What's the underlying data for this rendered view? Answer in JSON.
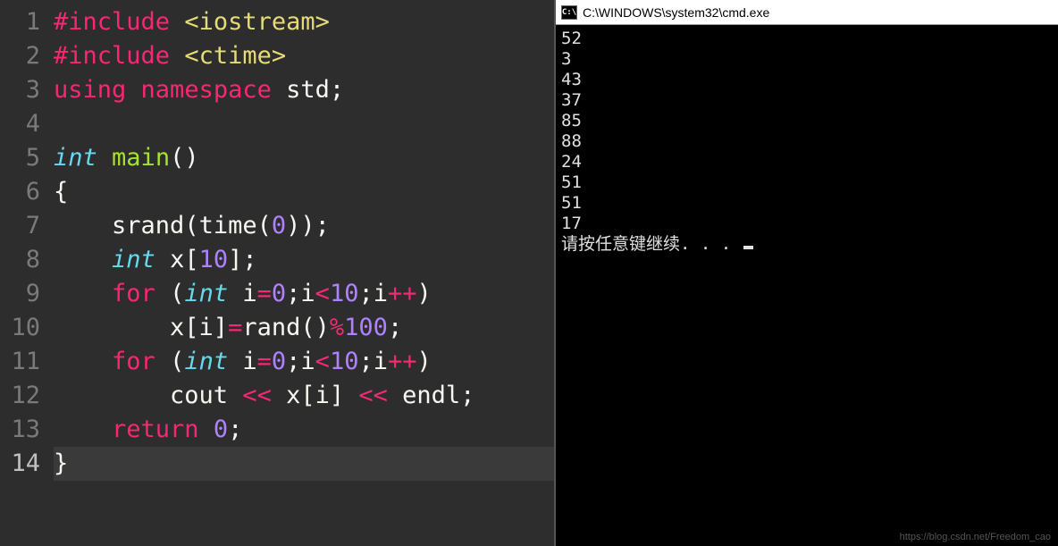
{
  "editor": {
    "active_line": 14,
    "lines": [
      {
        "n": "1",
        "tokens": [
          {
            "t": "#include",
            "c": "pink"
          },
          {
            "t": " ",
            "c": "white"
          },
          {
            "t": "<iostream>",
            "c": "yellow"
          }
        ]
      },
      {
        "n": "2",
        "tokens": [
          {
            "t": "#include",
            "c": "pink"
          },
          {
            "t": " ",
            "c": "white"
          },
          {
            "t": "<ctime>",
            "c": "yellow"
          }
        ]
      },
      {
        "n": "3",
        "tokens": [
          {
            "t": "using",
            "c": "pink"
          },
          {
            "t": " ",
            "c": "white"
          },
          {
            "t": "namespace",
            "c": "pink"
          },
          {
            "t": " std;",
            "c": "white"
          }
        ]
      },
      {
        "n": "4",
        "tokens": []
      },
      {
        "n": "5",
        "tokens": [
          {
            "t": "int",
            "c": "cyan"
          },
          {
            "t": " ",
            "c": "white"
          },
          {
            "t": "main",
            "c": "green"
          },
          {
            "t": "()",
            "c": "white"
          }
        ]
      },
      {
        "n": "6",
        "tokens": [
          {
            "t": "{",
            "c": "white"
          }
        ]
      },
      {
        "n": "7",
        "tokens": [
          {
            "t": "    ",
            "c": "white"
          },
          {
            "t": "srand",
            "c": "white"
          },
          {
            "t": "(",
            "c": "white"
          },
          {
            "t": "time",
            "c": "white"
          },
          {
            "t": "(",
            "c": "white"
          },
          {
            "t": "0",
            "c": "purple"
          },
          {
            "t": "));",
            "c": "white"
          }
        ]
      },
      {
        "n": "8",
        "tokens": [
          {
            "t": "    ",
            "c": "white"
          },
          {
            "t": "int",
            "c": "cyan"
          },
          {
            "t": " x[",
            "c": "white"
          },
          {
            "t": "10",
            "c": "purple"
          },
          {
            "t": "];",
            "c": "white"
          }
        ]
      },
      {
        "n": "9",
        "tokens": [
          {
            "t": "    ",
            "c": "white"
          },
          {
            "t": "for",
            "c": "pink"
          },
          {
            "t": " (",
            "c": "white"
          },
          {
            "t": "int",
            "c": "cyan"
          },
          {
            "t": " i",
            "c": "white"
          },
          {
            "t": "=",
            "c": "pink"
          },
          {
            "t": "0",
            "c": "purple"
          },
          {
            "t": ";i",
            "c": "white"
          },
          {
            "t": "<",
            "c": "pink"
          },
          {
            "t": "10",
            "c": "purple"
          },
          {
            "t": ";i",
            "c": "white"
          },
          {
            "t": "++",
            "c": "pink"
          },
          {
            "t": ")",
            "c": "white"
          }
        ]
      },
      {
        "n": "10",
        "tokens": [
          {
            "t": "        x[i]",
            "c": "white"
          },
          {
            "t": "=",
            "c": "pink"
          },
          {
            "t": "rand",
            "c": "white"
          },
          {
            "t": "()",
            "c": "white"
          },
          {
            "t": "%",
            "c": "pink"
          },
          {
            "t": "100",
            "c": "purple"
          },
          {
            "t": ";",
            "c": "white"
          }
        ]
      },
      {
        "n": "11",
        "tokens": [
          {
            "t": "    ",
            "c": "white"
          },
          {
            "t": "for",
            "c": "pink"
          },
          {
            "t": " (",
            "c": "white"
          },
          {
            "t": "int",
            "c": "cyan"
          },
          {
            "t": " i",
            "c": "white"
          },
          {
            "t": "=",
            "c": "pink"
          },
          {
            "t": "0",
            "c": "purple"
          },
          {
            "t": ";i",
            "c": "white"
          },
          {
            "t": "<",
            "c": "pink"
          },
          {
            "t": "10",
            "c": "purple"
          },
          {
            "t": ";i",
            "c": "white"
          },
          {
            "t": "++",
            "c": "pink"
          },
          {
            "t": ")",
            "c": "white"
          }
        ]
      },
      {
        "n": "12",
        "tokens": [
          {
            "t": "        cout ",
            "c": "white"
          },
          {
            "t": "<<",
            "c": "pink"
          },
          {
            "t": " x[i] ",
            "c": "white"
          },
          {
            "t": "<<",
            "c": "pink"
          },
          {
            "t": " endl;",
            "c": "white"
          }
        ]
      },
      {
        "n": "13",
        "tokens": [
          {
            "t": "    ",
            "c": "white"
          },
          {
            "t": "return",
            "c": "pink"
          },
          {
            "t": " ",
            "c": "white"
          },
          {
            "t": "0",
            "c": "purple"
          },
          {
            "t": ";",
            "c": "white"
          }
        ]
      },
      {
        "n": "14",
        "tokens": [
          {
            "t": "}",
            "c": "white"
          }
        ]
      }
    ]
  },
  "console": {
    "title": "C:\\WINDOWS\\system32\\cmd.exe",
    "icon_text": "C:\\",
    "output": [
      "52",
      "3",
      "43",
      "37",
      "85",
      "88",
      "24",
      "51",
      "51",
      "17"
    ],
    "prompt": "请按任意键继续. . . "
  },
  "watermark": "https://blog.csdn.net/Freedom_cao"
}
